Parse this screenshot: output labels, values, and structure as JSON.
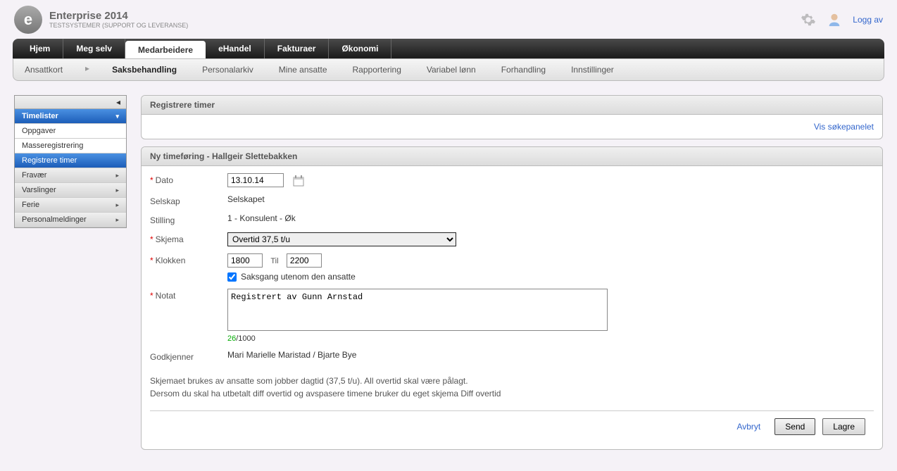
{
  "header": {
    "app_title": "Enterprise 2014",
    "app_sub": "TESTSYSTEMER (SUPPORT OG LEVERANSE)",
    "logout": "Logg av"
  },
  "main_nav": {
    "items": [
      "Hjem",
      "Meg selv",
      "Medarbeidere",
      "eHandel",
      "Fakturaer",
      "Økonomi"
    ],
    "active": 2
  },
  "sub_nav": {
    "items": [
      "Ansattkort",
      "Saksbehandling",
      "Personalarkiv",
      "Mine ansatte",
      "Rapportering",
      "Variabel lønn",
      "Forhandling",
      "Innstillinger"
    ],
    "active": 1
  },
  "sidebar": {
    "items": [
      {
        "label": "Timelister",
        "type": "header"
      },
      {
        "label": "Oppgaver",
        "type": "item"
      },
      {
        "label": "Masseregistrering",
        "type": "item"
      },
      {
        "label": "Registrere timer",
        "type": "selected"
      },
      {
        "label": "Fravær",
        "type": "expandable"
      },
      {
        "label": "Varslinger",
        "type": "expandable"
      },
      {
        "label": "Ferie",
        "type": "expandable"
      },
      {
        "label": "Personalmeldinger",
        "type": "expandable"
      }
    ]
  },
  "panels": {
    "top_title": "Registrere timer",
    "search_link": "Vis søkepanelet",
    "form_title": "Ny timeføring - Hallgeir Slettebakken"
  },
  "form": {
    "labels": {
      "dato": "Dato",
      "selskap": "Selskap",
      "stilling": "Stilling",
      "skjema": "Skjema",
      "klokken": "Klokken",
      "til": "Til",
      "saksgang": "Saksgang utenom den ansatte",
      "notat": "Notat",
      "godkjenner": "Godkjenner"
    },
    "values": {
      "dato": "13.10.14",
      "selskap": "Selskapet",
      "stilling": "1 - Konsulent - Øk",
      "skjema": "Overtid 37,5 t/u",
      "klokken_fra": "1800",
      "klokken_til": "2200",
      "notat": "Registrert av Gunn Arnstad",
      "godkjenner": "Mari Marielle Maristad / Bjarte Bye"
    },
    "char_count": {
      "current": "26",
      "max": "/1000"
    },
    "help1": "Skjemaet brukes av ansatte som jobber dagtid (37,5 t/u). All overtid skal være pålagt.",
    "help2": "Dersom du skal ha utbetalt diff overtid og avspasere timene bruker du eget skjema Diff overtid"
  },
  "footer": {
    "cancel": "Avbryt",
    "send": "Send",
    "save": "Lagre"
  }
}
